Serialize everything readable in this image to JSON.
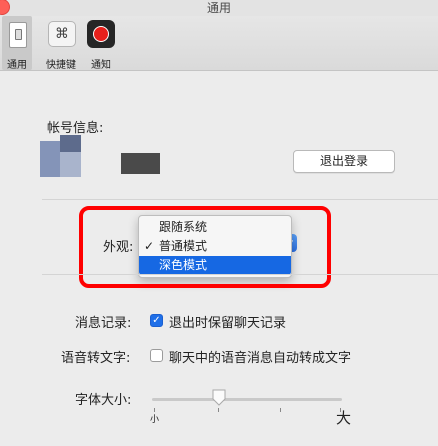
{
  "window": {
    "title": "通用"
  },
  "toolbar": {
    "items": [
      {
        "label": "通用",
        "icon": "general-switch-icon",
        "selected": true
      },
      {
        "label": "快捷键",
        "icon": "command-key-icon",
        "glyph": "⌘"
      },
      {
        "label": "通知",
        "icon": "record-dot-icon"
      }
    ]
  },
  "account": {
    "label": "帐号信息:",
    "logout_label": "退出登录"
  },
  "appearance": {
    "label": "外观:",
    "options": [
      {
        "label": "跟随系统",
        "checked": false,
        "highlighted": false
      },
      {
        "label": "普通模式",
        "checked": true,
        "highlighted": false
      },
      {
        "label": "深色模式",
        "checked": false,
        "highlighted": true
      }
    ],
    "highlight_color": "#1668e3",
    "annotation_color": "#ff0000"
  },
  "message_history": {
    "label": "消息记录:",
    "checkbox_label": "退出时保留聊天记录",
    "checked": true
  },
  "speech_to_text": {
    "label": "语音转文字:",
    "checkbox_label": "聊天中的语音消息自动转成文字",
    "checked": false
  },
  "font_size": {
    "label": "字体大小:",
    "min_label": "小",
    "max_label": "大",
    "level_fraction": 0.35
  }
}
